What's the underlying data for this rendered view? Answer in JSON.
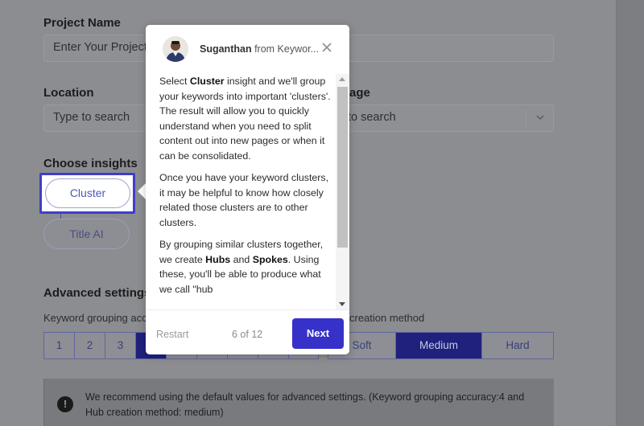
{
  "form": {
    "project_name_label": "Project Name",
    "project_name_placeholder": "Enter Your Project",
    "location_label": "Location",
    "location_placeholder": "Type to search",
    "language_label_tail": "age",
    "language_placeholder_tail": "to search",
    "choose_insights_label": "Choose insights",
    "insights": [
      "Cluster",
      "Title AI"
    ],
    "advanced_label": "Advanced settings",
    "grouping_label": "Keyword grouping acc",
    "hub_label_tail": "creation method",
    "grouping_options": [
      "1",
      "2",
      "3"
    ],
    "hub_options": [
      "Soft",
      "Medium",
      "Hard"
    ],
    "hub_selected": "Medium",
    "notice_icon": "!",
    "notice_text": "We recommend using the default values for advanced settings. (Keyword grouping accuracy:4 and Hub creation method: medium)"
  },
  "tooltip": {
    "author_name": "Suganthan",
    "author_from": "from Keywor...",
    "paragraphs": [
      "Select <b>Cluster</b> insight and we'll group your keywords into important 'clusters'. The result will allow you to quickly understand when you need to split content out into new pages or when it can be consolidated.",
      "Once you have your keyword clusters, it may be helpful to know how closely related those clusters are to other clusters.",
      "By grouping similar clusters together, we create <b>Hubs</b> and <b>Spokes</b>. Using these, you'll be able to produce what we call \"hub"
    ],
    "restart_label": "Restart",
    "step_counter": "6 of 12",
    "next_label": "Next"
  },
  "colors": {
    "accent": "#3631c9",
    "selected_segment": "#1f217c"
  }
}
